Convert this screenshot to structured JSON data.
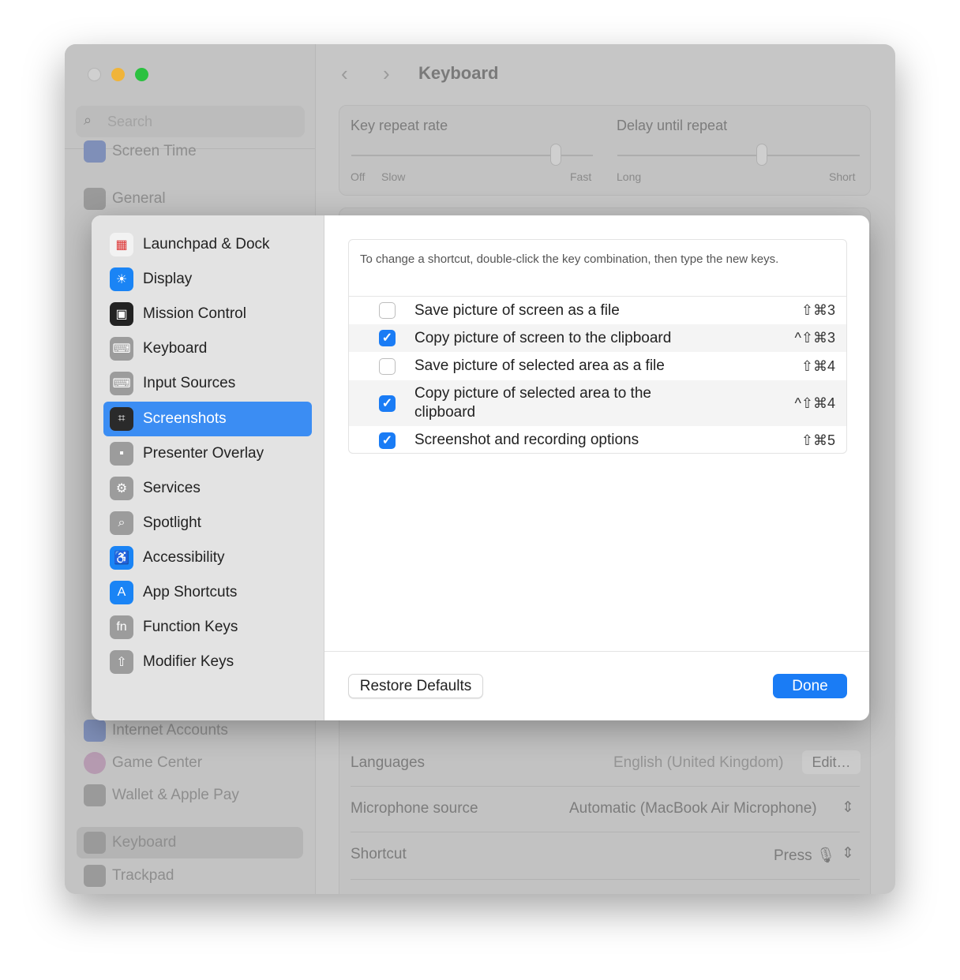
{
  "window": {
    "title": "Keyboard",
    "search_placeholder": "Search"
  },
  "bg_sidebar": [
    "Screen Time",
    "General",
    "Internet Accounts",
    "Game Center",
    "Wallet & Apple Pay",
    "Keyboard",
    "Trackpad"
  ],
  "bg_main": {
    "key_repeat_rate": "Key repeat rate",
    "delay_until_repeat": "Delay until repeat",
    "off": "Off",
    "slow": "Slow",
    "fast": "Fast",
    "long": "Long",
    "short": "Short",
    "key_repeat_value": 0.75,
    "delay_value": 0.6,
    "languages_label": "Languages",
    "languages_value": "English (United Kingdom)",
    "edit_button": "Edit…",
    "mic_label": "Microphone source",
    "mic_value": "Automatic (MacBook Air Microphone)",
    "shortcut_label": "Shortcut",
    "shortcut_value": "Press 🎙"
  },
  "sheet": {
    "sidebar": [
      {
        "label": "Launchpad & Dock",
        "icon": "launchpad-icon",
        "color": "#f2f2f2"
      },
      {
        "label": "Display",
        "icon": "sun-icon",
        "color": "#1a84f5"
      },
      {
        "label": "Mission Control",
        "icon": "mission-control-icon",
        "color": "#222222"
      },
      {
        "label": "Keyboard",
        "icon": "keyboard-icon",
        "color": "#9c9c9c"
      },
      {
        "label": "Input Sources",
        "icon": "keyboard-icon",
        "color": "#9c9c9c"
      },
      {
        "label": "Screenshots",
        "icon": "screenshot-icon",
        "color": "#2a2a2a",
        "selected": true
      },
      {
        "label": "Presenter Overlay",
        "icon": "presenter-icon",
        "color": "#9c9c9c"
      },
      {
        "label": "Services",
        "icon": "gears-icon",
        "color": "#9c9c9c"
      },
      {
        "label": "Spotlight",
        "icon": "magnifier-icon",
        "color": "#9c9c9c"
      },
      {
        "label": "Accessibility",
        "icon": "accessibility-icon",
        "color": "#1a84f5"
      },
      {
        "label": "App Shortcuts",
        "icon": "app-store-icon",
        "color": "#1a84f5"
      },
      {
        "label": "Function Keys",
        "icon": "fn-icon",
        "color": "#9c9c9c"
      },
      {
        "label": "Modifier Keys",
        "icon": "shift-arrow-icon",
        "color": "#9c9c9c"
      }
    ],
    "hint": "To change a shortcut, double-click the key combination, then type the new keys.",
    "shortcuts": [
      {
        "label": "Save picture of screen as a file",
        "keys": "⇧⌘3",
        "checked": false
      },
      {
        "label": "Copy picture of screen to the clipboard",
        "keys": "^⇧⌘3",
        "checked": true
      },
      {
        "label": "Save picture of selected area as a file",
        "keys": "⇧⌘4",
        "checked": false
      },
      {
        "label": "Copy picture of selected area to the clipboard",
        "keys": "^⇧⌘4",
        "checked": true
      },
      {
        "label": "Screenshot and recording options",
        "keys": "⇧⌘5",
        "checked": true
      }
    ],
    "restore_defaults": "Restore Defaults",
    "done": "Done",
    "check": "✓"
  }
}
